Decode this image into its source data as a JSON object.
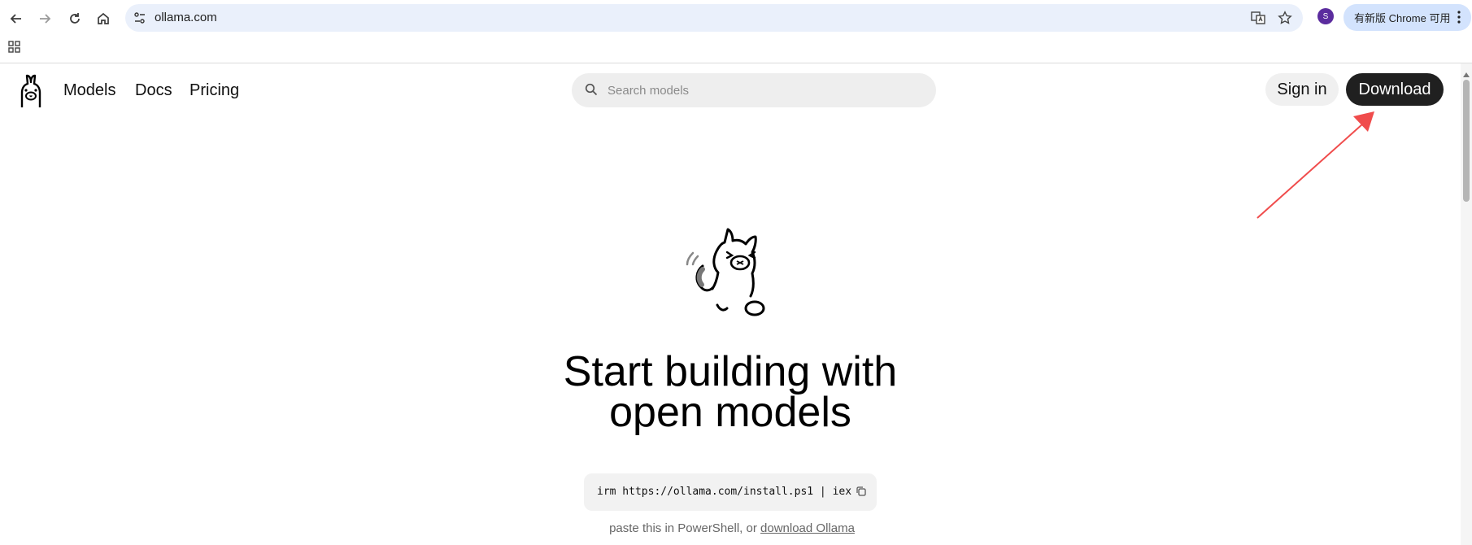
{
  "browser": {
    "url": "ollama.com",
    "profile_initial": "S",
    "update_label": "有新版 Chrome 可用"
  },
  "header": {
    "nav": [
      "Models",
      "Docs",
      "Pricing"
    ],
    "search_placeholder": "Search models",
    "signin_label": "Sign in",
    "download_label": "Download"
  },
  "hero": {
    "title_line1": "Start building with",
    "title_line2": "open models",
    "command": "irm https://ollama.com/install.ps1 | iex",
    "note_prefix": "paste this in PowerShell, or ",
    "note_link": "download Ollama"
  },
  "colors": {
    "download_bg": "#202020",
    "annotation_arrow": "#f04c4c",
    "omnibox_bg": "#eaf0fb",
    "update_pill_bg": "#d3e3fd"
  },
  "icons": [
    "back-icon",
    "forward-icon",
    "reload-icon",
    "home-icon",
    "site-settings-icon",
    "translate-icon",
    "star-icon",
    "menu-dots-icon",
    "apps-grid-icon",
    "ollama-logo",
    "search-icon",
    "copy-icon"
  ]
}
